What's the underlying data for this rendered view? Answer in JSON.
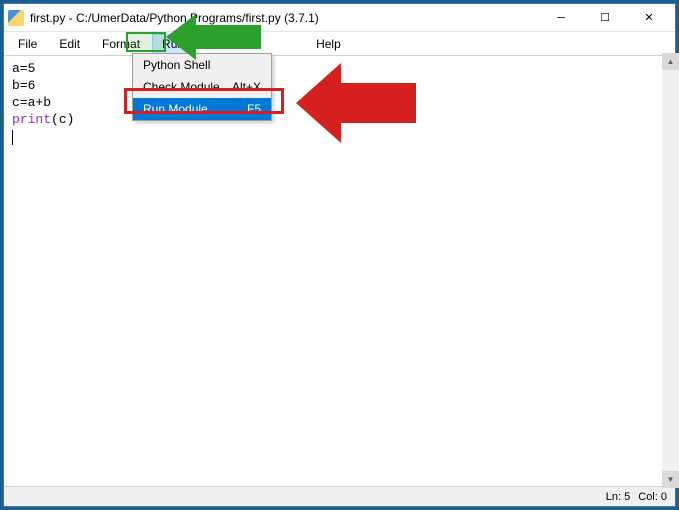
{
  "title": "first.py - C:/UmerData/Python Programs/first.py (3.7.1)",
  "menubar": {
    "file": "File",
    "edit": "Edit",
    "format": "Format",
    "run": "Run",
    "help": "Help"
  },
  "dropdown": {
    "python_shell": "Python Shell",
    "check_module": {
      "label": "Check Module",
      "shortcut": "Alt+X"
    },
    "run_module": {
      "label": "Run Module",
      "shortcut": "F5"
    }
  },
  "code": {
    "l1": "a=5",
    "l2": "b=6",
    "l3": "c=a+b",
    "l4_kw": "print",
    "l4_rest": "(c)"
  },
  "status": {
    "ln": "Ln: 5",
    "col": "Col: 0"
  },
  "colors": {
    "green_arrow": "#2ca02c",
    "red_arrow": "#d62020",
    "selection": "#0078d7"
  }
}
